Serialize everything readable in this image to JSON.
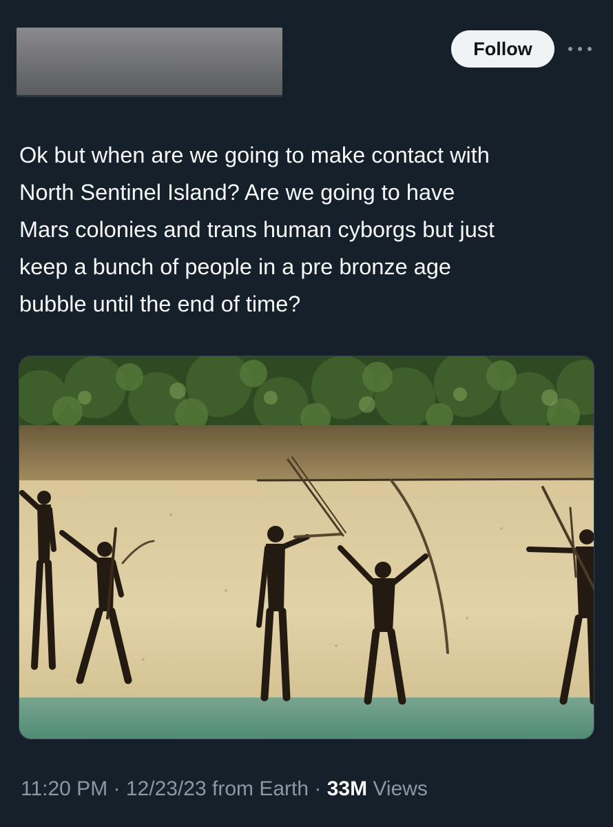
{
  "header": {
    "follow_label": "Follow",
    "more_icon": "more-horizontal-icon"
  },
  "tweet": {
    "text": "Ok but when are we going to make contact with\nNorth Sentinel Island? Are we going to have\nMars colonies and trans human cyborgs but just\nkeep a bunch of people in a pre bronze age\nbubble until the end of time?",
    "time": "11:20 PM",
    "separator": "·",
    "date": "12/23/23",
    "source": "from Earth",
    "views_count": "33M",
    "views_label": "Views"
  },
  "colors": {
    "background": "#15202b",
    "text_primary": "#f7f9f9",
    "text_secondary": "#8b98a5",
    "button_bg": "#eff3f4",
    "border": "#38444d"
  }
}
